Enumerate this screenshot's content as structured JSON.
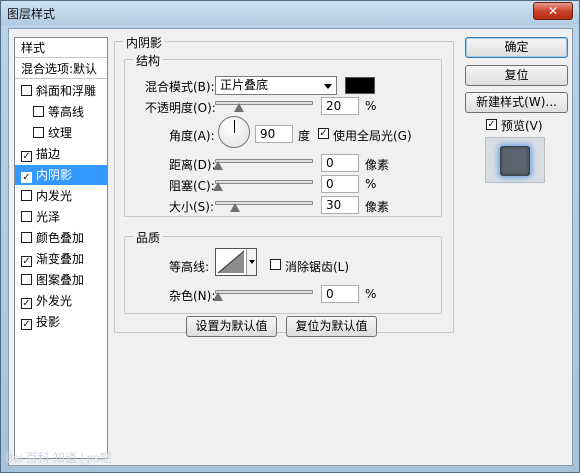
{
  "window": {
    "title": "图层样式",
    "close_glyph": "✕"
  },
  "style_list": {
    "items": [
      {
        "label": "样式",
        "checkbox": false,
        "checked": false,
        "indent": false,
        "header": true
      },
      {
        "label": "混合选项:默认",
        "checkbox": false,
        "checked": false,
        "indent": false,
        "header": true
      },
      {
        "label": "斜面和浮雕",
        "checkbox": true,
        "checked": false,
        "indent": false
      },
      {
        "label": "等高线",
        "checkbox": true,
        "checked": false,
        "indent": true
      },
      {
        "label": "纹理",
        "checkbox": true,
        "checked": false,
        "indent": true
      },
      {
        "label": "描边",
        "checkbox": true,
        "checked": true,
        "indent": false
      },
      {
        "label": "内阴影",
        "checkbox": true,
        "checked": true,
        "indent": false,
        "selected": true
      },
      {
        "label": "内发光",
        "checkbox": true,
        "checked": false,
        "indent": false
      },
      {
        "label": "光泽",
        "checkbox": true,
        "checked": false,
        "indent": false
      },
      {
        "label": "颜色叠加",
        "checkbox": true,
        "checked": false,
        "indent": false
      },
      {
        "label": "渐变叠加",
        "checkbox": true,
        "checked": true,
        "indent": false
      },
      {
        "label": "图案叠加",
        "checkbox": true,
        "checked": false,
        "indent": false
      },
      {
        "label": "外发光",
        "checkbox": true,
        "checked": true,
        "indent": false
      },
      {
        "label": "投影",
        "checkbox": true,
        "checked": true,
        "indent": false
      }
    ]
  },
  "panel": {
    "title": "内阴影",
    "structure": {
      "title": "结构",
      "blend_mode_label": "混合模式(B):",
      "blend_mode_value": "正片叠底",
      "blend_color": "#000000",
      "opacity_label": "不透明度(O):",
      "opacity_value": "20",
      "opacity_unit": "%",
      "angle_label": "角度(A):",
      "angle_value": "90",
      "angle_unit": "度",
      "global_light_label": "使用全局光(G)",
      "global_light_checked": true,
      "distance_label": "距离(D):",
      "distance_value": "0",
      "distance_unit": "像素",
      "choke_label": "阻塞(C):",
      "choke_value": "0",
      "choke_unit": "%",
      "size_label": "大小(S):",
      "size_value": "30",
      "size_unit": "像素"
    },
    "quality": {
      "title": "品质",
      "contour_label": "等高线:",
      "antialias_label": "消除锯齿(L)",
      "antialias_checked": false,
      "noise_label": "杂色(N):",
      "noise_value": "0",
      "noise_unit": "%"
    },
    "make_default_label": "设置为默认值",
    "reset_default_label": "复位为默认值"
  },
  "buttons": {
    "ok": "确定",
    "reset": "复位",
    "new_style": "新建样式(W)...",
    "preview_label": "预览(V)",
    "preview_checked": true
  },
  "watermark": "Bai 百科 知道 | ps吧"
}
